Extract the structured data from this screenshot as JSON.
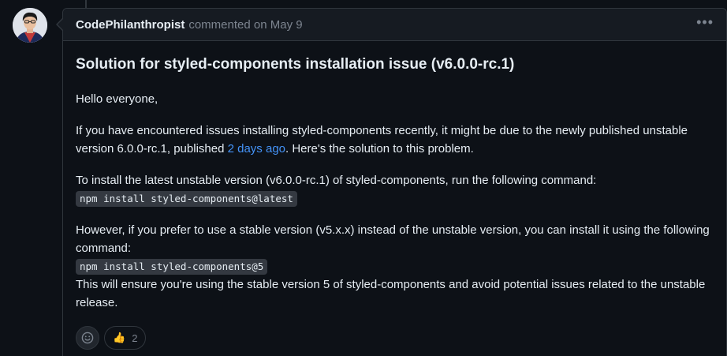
{
  "comment": {
    "author": "CodePhilanthropist",
    "meta": "commented on May 9",
    "menu_icon": "kebab-horizontal-icon",
    "title": "Solution for styled-components installation issue (v6.0.0-rc.1)",
    "greeting": "Hello everyone,",
    "p1_before": "If you have encountered issues installing styled-components recently, it might be due to the newly published unstable version 6.0.0-rc.1, published ",
    "p1_link": "2 days ago",
    "p1_after": ". Here's the solution to this problem.",
    "p2": "To install the latest unstable version (v6.0.0-rc.1) of styled-components, run the following command:",
    "code1": "npm install styled-components@latest",
    "p3": "However, if you prefer to use a stable version (v5.x.x) instead of the unstable version, you can install it using the following command:",
    "code2": "npm install styled-components@5",
    "p4": "This will ensure you're using the stable version 5 of styled-components and avoid potential issues related to the unstable release."
  },
  "reactions": {
    "add_icon": "smiley-icon",
    "thumbs_up_icon": "thumbs-up-icon",
    "thumbs_up_emoji": "👍",
    "thumbs_up_count": "2"
  },
  "colors": {
    "background": "#0d1117",
    "header": "#161b22",
    "border": "#30363d",
    "link": "#4493f8",
    "muted": "#7d8590"
  }
}
